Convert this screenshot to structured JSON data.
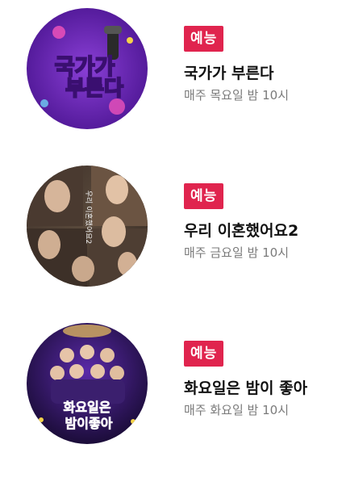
{
  "programs": [
    {
      "badge": "예능",
      "title": "국가가 부른다",
      "schedule": "매주 목요일 밤 10시",
      "thumb_text": [
        "국가가",
        "부른다"
      ]
    },
    {
      "badge": "예능",
      "title": "우리 이혼했어요2",
      "schedule": "매주 금요일 밤 10시",
      "thumb_text": [
        "우리 이혼했어요2"
      ]
    },
    {
      "badge": "예능",
      "title": "화요일은 밤이 좋아",
      "schedule": "매주 화요일 밤 10시",
      "thumb_text": [
        "화요일은",
        "밤이좋아"
      ]
    }
  ],
  "colors": {
    "badge": "#e0244e",
    "title": "#111111",
    "schedule": "#7a7a7a"
  }
}
